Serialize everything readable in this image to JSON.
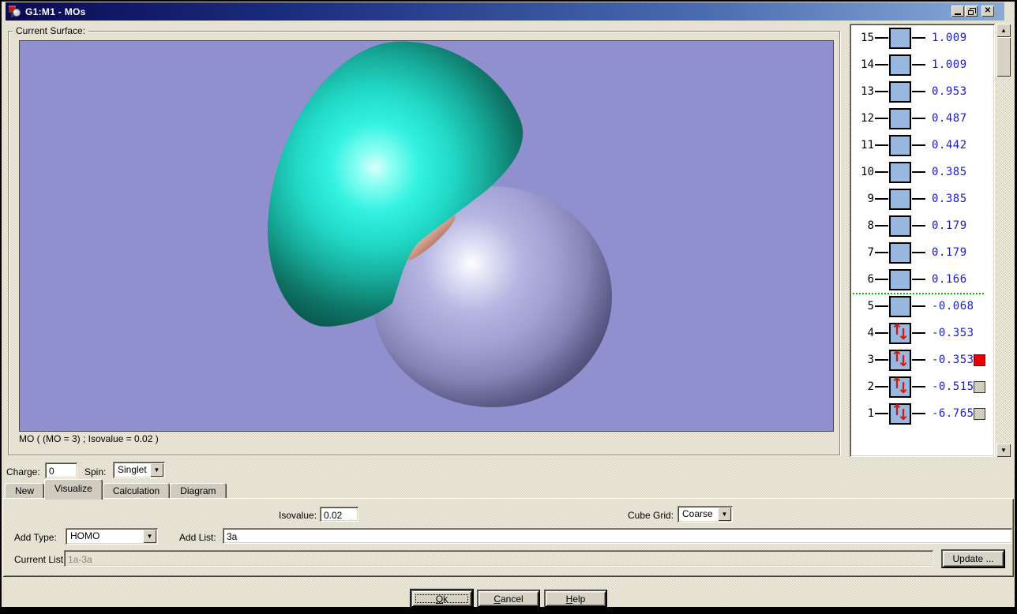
{
  "window": {
    "title": "G1:M1 - MOs"
  },
  "surface_group": {
    "label": "Current Surface:",
    "caption": "MO ( (MO = 3) ; Isovalue = 0.02 )"
  },
  "scene": {
    "description": "molecular orbital isosurface, MO 3",
    "positive_lobe_color": "#2af0de",
    "negative_lobe_color": "#a0a0d2",
    "atom_color": "#d49a8a",
    "background_color": "#9090ce"
  },
  "mo_levels": {
    "divider_after_row": 6,
    "divider_color": "#00bb00",
    "energy_text_color": "#1a1acd",
    "box_fill": "#aac8e8",
    "arrow_color": "#dd1505",
    "marker_red_color": "#e60000",
    "rows": [
      {
        "num": 15,
        "energy": "1.009",
        "occupied": false,
        "marker": null
      },
      {
        "num": 14,
        "energy": "1.009",
        "occupied": false,
        "marker": null
      },
      {
        "num": 13,
        "energy": "0.953",
        "occupied": false,
        "marker": null
      },
      {
        "num": 12,
        "energy": "0.487",
        "occupied": false,
        "marker": null
      },
      {
        "num": 11,
        "energy": "0.442",
        "occupied": false,
        "marker": null
      },
      {
        "num": 10,
        "energy": "0.385",
        "occupied": false,
        "marker": null
      },
      {
        "num": 9,
        "energy": "0.385",
        "occupied": false,
        "marker": null
      },
      {
        "num": 8,
        "energy": "0.179",
        "occupied": false,
        "marker": null
      },
      {
        "num": 7,
        "energy": "0.179",
        "occupied": false,
        "marker": null
      },
      {
        "num": 6,
        "energy": "0.166",
        "occupied": false,
        "marker": null
      },
      {
        "num": 5,
        "energy": "-0.068",
        "occupied": false,
        "marker": null
      },
      {
        "num": 4,
        "energy": "-0.353",
        "occupied": true,
        "marker": null
      },
      {
        "num": 3,
        "energy": "-0.353",
        "occupied": true,
        "marker": "red"
      },
      {
        "num": 2,
        "energy": "-0.515",
        "occupied": true,
        "marker": "gray"
      },
      {
        "num": 1,
        "energy": "-6.765",
        "occupied": true,
        "marker": "gray"
      }
    ]
  },
  "charge_spin": {
    "charge_label": "Charge:",
    "charge_value": "0",
    "spin_label": "Spin:",
    "spin_value": "Singlet"
  },
  "tabs": {
    "items": [
      "New",
      "Visualize",
      "Calculation",
      "Diagram"
    ],
    "active": "Visualize"
  },
  "visualize_panel": {
    "isovalue_label": "Isovalue:",
    "isovalue_value": "0.02",
    "cube_grid_label": "Cube Grid:",
    "cube_grid_value": "Coarse",
    "add_type_label": "Add Type:",
    "add_type_value": "HOMO",
    "add_list_label": "Add List:",
    "add_list_value": "3a",
    "current_list_label": "Current List:",
    "current_list_value": "1a-3a",
    "update_button_label": "Update ..."
  },
  "footer": {
    "ok": "Ok",
    "cancel": "Cancel",
    "help": "Help"
  },
  "glyphs": {
    "close": "✕",
    "combo_arrow": "▼",
    "scroll_up": "▲",
    "scroll_down": "▼",
    "arrow_up": "↑",
    "arrow_down": "↓"
  }
}
